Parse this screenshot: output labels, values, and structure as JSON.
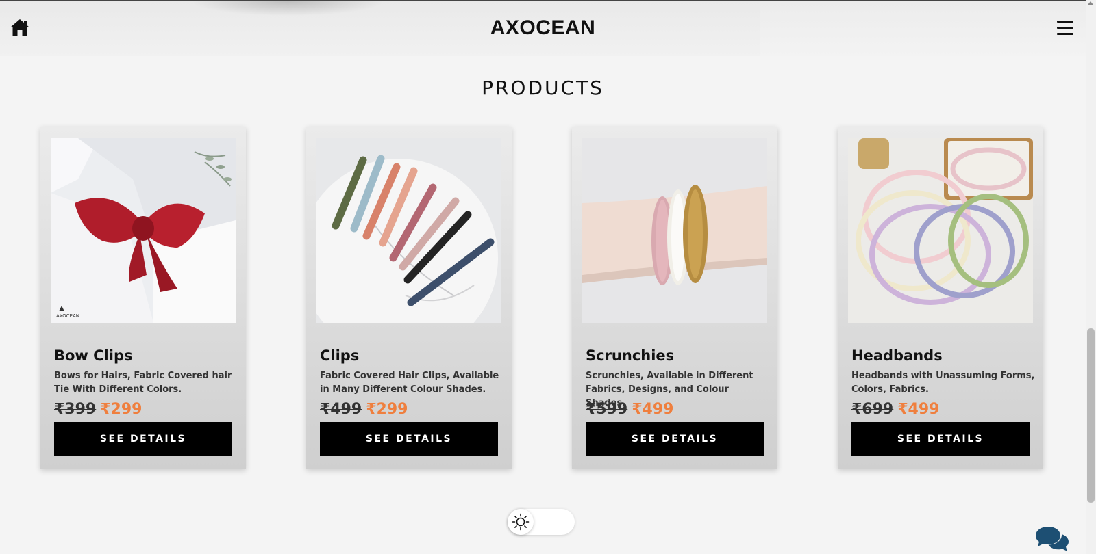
{
  "header": {
    "brand": "AXOCEAN",
    "home_icon": "home-icon",
    "menu_icon": "hamburger-menu-icon"
  },
  "section": {
    "title": "PRODUCTS"
  },
  "products": [
    {
      "title": "Bow Clips",
      "description": "Bows for Hairs, Fabric Covered hair Tie With Different Colors.",
      "old_price": "₹399",
      "new_price": "₹299",
      "button_label": "SEE DETAILS",
      "image_logo_text": "AXOCEAN"
    },
    {
      "title": "Clips",
      "description": "Fabric Covered Hair Clips, Available in Many Different Colour Shades.",
      "old_price": "₹499",
      "new_price": "₹299",
      "button_label": "SEE DETAILS"
    },
    {
      "title": "Scrunchies",
      "description": "Scrunchies, Available in Different Fabrics, Designs, and Colour Shades.",
      "old_price": "₹599",
      "new_price": "₹499",
      "button_label": "SEE DETAILS"
    },
    {
      "title": "Headbands",
      "description": "Headbands with Unassuming Forms, Colors, Fabrics.",
      "old_price": "₹699",
      "new_price": "₹499",
      "button_label": "SEE DETAILS"
    }
  ],
  "theme_toggle": {
    "icon": "sun-icon",
    "mode": "light"
  },
  "chat": {
    "icon": "chat-bubbles-icon"
  },
  "colors": {
    "accent_price": "#ef7f3e",
    "button_bg": "#000000",
    "chat_icon": "#1d4f73"
  }
}
